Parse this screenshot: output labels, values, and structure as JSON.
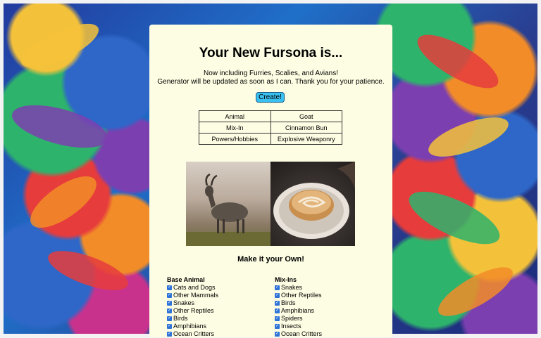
{
  "page": {
    "title": "Your New Fursona is...",
    "subtitle_lines": [
      "Now including Furries, Scalies, and Avians!",
      "Generator will be updated as soon as I can. Thank you for your patience."
    ],
    "create_label": "Create!"
  },
  "result_table": [
    {
      "label": "Animal",
      "value": "Goat"
    },
    {
      "label": "Mix-In",
      "value": "Cinnamon Bun"
    },
    {
      "label": "Powers/Hobbies",
      "value": "Explosive Weaponry"
    }
  ],
  "images": {
    "animal_icon": "goat-photo",
    "mixin_icon": "cinnamon-bun-photo"
  },
  "customize": {
    "title": "Make it your Own!",
    "base_animal": {
      "heading": "Base Animal",
      "options": [
        "Cats and Dogs",
        "Other Mammals",
        "Snakes",
        "Other Reptiles",
        "Birds",
        "Amphibians",
        "Ocean Critters"
      ]
    },
    "mix_ins": {
      "heading": "Mix-Ins",
      "options": [
        "Snakes",
        "Other Reptiles",
        "Birds",
        "Amphibians",
        "Spiders",
        "Insects",
        "Ocean Critters"
      ]
    }
  },
  "colors": {
    "panel_bg": "#fdfde3",
    "button_bg": "#39c0f0",
    "checkbox": "#2f73d8"
  }
}
